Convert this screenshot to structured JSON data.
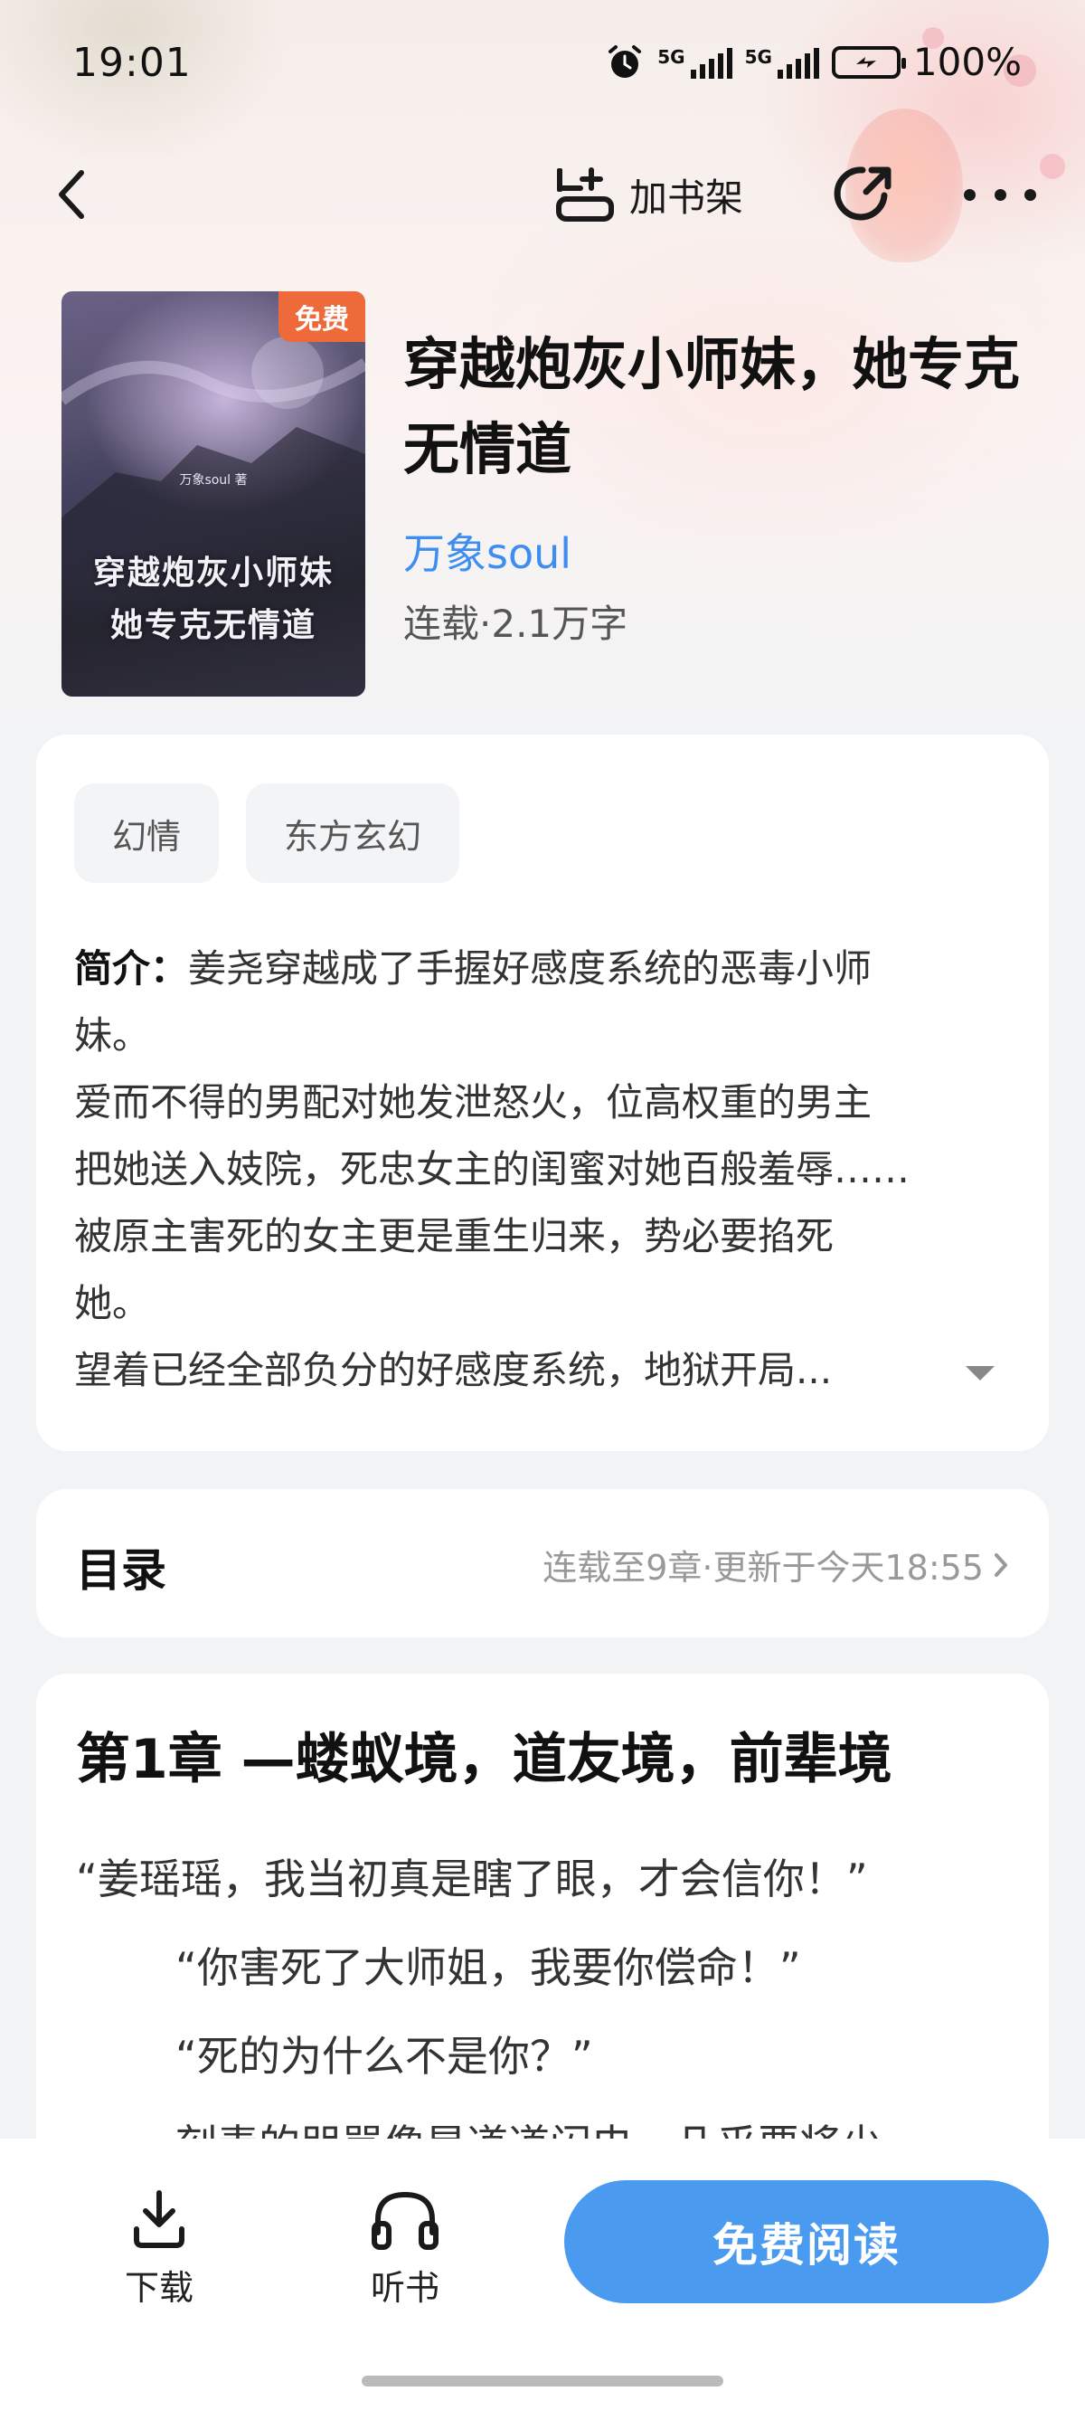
{
  "status_bar": {
    "time": "19:01",
    "signal_1": "5G",
    "signal_2": "5G",
    "battery": "100%"
  },
  "nav": {
    "add_to_shelf": "加书架"
  },
  "book": {
    "free_badge": "免费",
    "cover_author": "万象soul 著",
    "cover_title_line1": "穿越炮灰小师妹",
    "cover_title_line2": "她专克无情道",
    "title": "穿越炮灰小师妹，她专克无情道",
    "author": "万象soul",
    "meta": "连载·2.1万字"
  },
  "tags": [
    "幻情",
    "东方玄幻"
  ],
  "intro": {
    "label": "简介：",
    "line1_rest": "姜尧穿越成了手握好感度系统的恶毒小师",
    "lines": [
      "妹。",
      "爱而不得的男配对她发泄怒火，位高权重的男主",
      "把她送入妓院，死忠女主的闺蜜对她百般羞辱……",
      "被原主害死的女主更是重生归来，势必要掐死",
      "她。",
      "望着已经全部负分的好感度系统，地狱开局..."
    ]
  },
  "toc": {
    "title": "目录",
    "info": "连载至9章·更新于今天18:55"
  },
  "chapter": {
    "title": "第1章 —蝼蚁境，道友境，前辈境",
    "paragraphs": [
      "“姜瑶瑶，我当初真是瞎了眼，才会信你！”",
      "“你害死了大师姐，我要你偿命！”",
      "“死的为什么不是你？”",
      "刻毒的咒骂像是道道闪电，几乎要将少"
    ]
  },
  "bottom_bar": {
    "download": "下载",
    "listen": "听书",
    "read": "免费阅读"
  }
}
